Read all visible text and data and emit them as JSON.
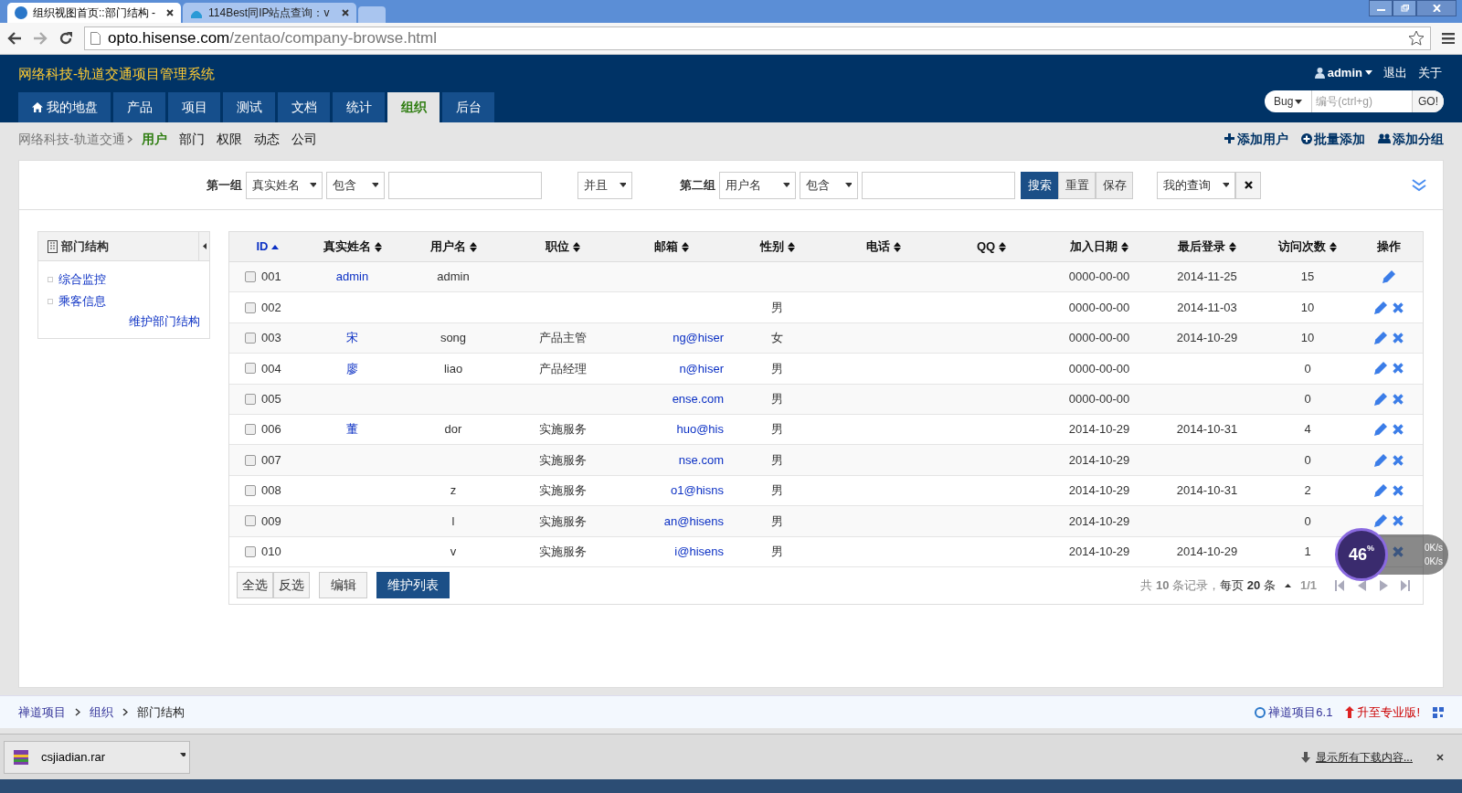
{
  "browser": {
    "tabs": [
      {
        "title": "组织视图首页::部门结构 -",
        "selected": true
      },
      {
        "title": "114Best同IP站点查询：v",
        "selected": false
      }
    ],
    "url_host": "opto.hisense.com",
    "url_path": "/zentao/company-browse.html"
  },
  "header": {
    "title": "网络科技-轨道交通项目管理系统",
    "user": "admin",
    "links": [
      "退出",
      "关于"
    ],
    "search_type": "Bug",
    "search_placeholder": "编号(ctrl+g)",
    "go": "GO!"
  },
  "nav": [
    {
      "label": "我的地盘",
      "selected": false
    },
    {
      "label": "产品",
      "selected": false
    },
    {
      "label": "项目",
      "selected": false
    },
    {
      "label": "测试",
      "selected": false
    },
    {
      "label": "文档",
      "selected": false
    },
    {
      "label": "统计",
      "selected": false
    },
    {
      "label": "组织",
      "selected": true
    },
    {
      "label": "后台",
      "selected": false
    }
  ],
  "subnav": {
    "root": "网络科技-轨道交通",
    "items": [
      {
        "label": "用户",
        "selected": true
      },
      {
        "label": "部门",
        "selected": false
      },
      {
        "label": "权限",
        "selected": false
      },
      {
        "label": "动态",
        "selected": false
      },
      {
        "label": "公司",
        "selected": false
      }
    ],
    "actions": [
      "添加用户",
      "批量添加",
      "添加分组"
    ]
  },
  "filter": {
    "group1": "第一组",
    "field1": "真实姓名",
    "op1": "包含",
    "logic": "并且",
    "group2": "第二组",
    "field2": "用户名",
    "op2": "包含",
    "buttons": [
      "搜索",
      "重置",
      "保存"
    ],
    "query": "我的查询"
  },
  "sidebar": {
    "title": "部门结构",
    "items": [
      "综合监控",
      "乘客信息"
    ],
    "link": "维护部门结构"
  },
  "table": {
    "columns": [
      "ID",
      "真实姓名",
      "用户名",
      "职位",
      "邮箱",
      "性别",
      "电话",
      "QQ",
      "加入日期",
      "最后登录",
      "访问次数",
      "操作"
    ],
    "rows": [
      {
        "checked": false,
        "id": "001",
        "realname": "admin",
        "username": "admin",
        "job": "",
        "email": "",
        "gender": "",
        "join": "0000-00-00",
        "last": "2014-11-25",
        "visits": "15",
        "editable": true,
        "deletable": false
      },
      {
        "checked": false,
        "id": "002",
        "realname": "",
        "username": "",
        "job": "",
        "email": "",
        "gender": "男",
        "join": "0000-00-00",
        "last": "2014-11-03",
        "visits": "10",
        "editable": true,
        "deletable": true
      },
      {
        "checked": false,
        "id": "003",
        "realname": "宋",
        "username": "song",
        "job": "产品主管",
        "email": "ng@hiser",
        "gender": "女",
        "join": "0000-00-00",
        "last": "2014-10-29",
        "visits": "10",
        "editable": true,
        "deletable": true
      },
      {
        "checked": false,
        "id": "004",
        "realname": "廖",
        "username": "liao",
        "job": "产品经理",
        "email": "n@hiser",
        "gender": "男",
        "join": "0000-00-00",
        "last": "",
        "visits": "0",
        "editable": true,
        "deletable": true
      },
      {
        "checked": false,
        "id": "005",
        "realname": "",
        "username": "",
        "job": "",
        "email": "ense.com",
        "gender": "男",
        "join": "0000-00-00",
        "last": "",
        "visits": "0",
        "editable": true,
        "deletable": true
      },
      {
        "checked": false,
        "id": "006",
        "realname": "董",
        "username": "dor",
        "job": "实施服务",
        "email": "huo@his",
        "gender": "男",
        "join": "2014-10-29",
        "last": "2014-10-31",
        "visits": "4",
        "editable": true,
        "deletable": true
      },
      {
        "checked": false,
        "id": "007",
        "realname": "",
        "username": "",
        "job": "实施服务",
        "email": "nse.com",
        "gender": "男",
        "join": "2014-10-29",
        "last": "",
        "visits": "0",
        "editable": true,
        "deletable": true
      },
      {
        "checked": false,
        "id": "008",
        "realname": "",
        "username": "z",
        "job": "实施服务",
        "email": "o1@hisns",
        "gender": "男",
        "join": "2014-10-29",
        "last": "2014-10-31",
        "visits": "2",
        "editable": true,
        "deletable": true
      },
      {
        "checked": false,
        "id": "009",
        "realname": "",
        "username": "l",
        "job": "实施服务",
        "email": "an@hisens",
        "gender": "男",
        "join": "2014-10-29",
        "last": "",
        "visits": "0",
        "editable": true,
        "deletable": true
      },
      {
        "checked": false,
        "id": "010",
        "realname": "",
        "username": "v",
        "job": "实施服务",
        "email": "i@hisens",
        "gender": "男",
        "join": "2014-10-29",
        "last": "2014-10-29",
        "visits": "1",
        "editable": false,
        "deletable": true
      }
    ],
    "buttons": [
      "全选",
      "反选",
      "编辑",
      "维护列表"
    ],
    "pager": {
      "prefix": "共",
      "total": "10",
      "mid": "条记录，每页",
      "per": "20",
      "suffix": "条",
      "pages": "1/1"
    }
  },
  "widget": {
    "percent": "46",
    "unit": "%",
    "up": "0K/s",
    "down": "0K/s"
  },
  "footer": {
    "crumbs": [
      "禅道项目",
      "组织",
      "部门结构"
    ],
    "version": "禅道项目6.1",
    "upgrade": "升至专业版!"
  },
  "downloads": {
    "file": "csjiadian.rar",
    "show_all": "显示所有下载内容..."
  }
}
